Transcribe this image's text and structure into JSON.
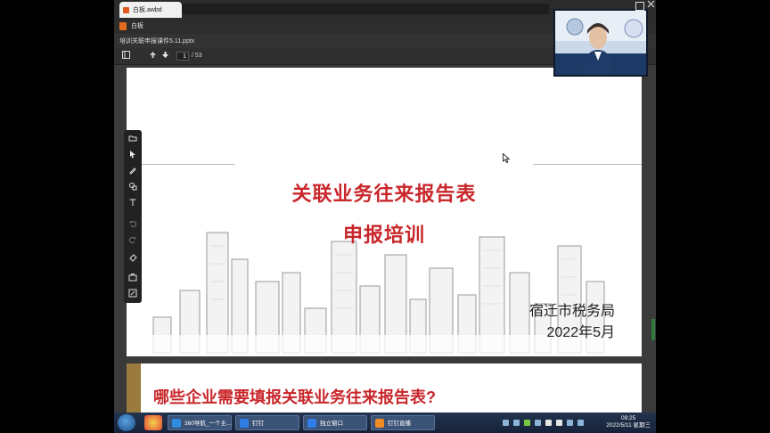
{
  "browser": {
    "tab_title": "白板.awbd"
  },
  "app": {
    "title": "白板"
  },
  "document": {
    "file_name": "培训关联申报课件5.11.pptx",
    "current_page": "1",
    "total_pages": "/ 53"
  },
  "slide1": {
    "title_line1": "关联业务往来报告表",
    "title_line2": "申报培训",
    "organization": "宿迁市税务局",
    "date": "2022年5月"
  },
  "slide2": {
    "heading": "哪些企业需要填报关联业务往来报告表?"
  },
  "annotation_tools": [
    "folder-add-icon",
    "select-arrow-icon",
    "pen-icon",
    "shapes-icon",
    "text-icon",
    "undo-icon",
    "redo-icon",
    "eraser-icon",
    "toolbox-icon",
    "edit-board-icon"
  ],
  "taskbar": {
    "tasks": [
      {
        "label": "360导航_一个主...",
        "icon": "ie-icon"
      },
      {
        "label": "钉钉",
        "icon": "dingtalk-icon"
      },
      {
        "label": "独立窗口",
        "icon": "dingtalk-icon"
      },
      {
        "label": "钉钉直播",
        "icon": "live-icon"
      }
    ],
    "time": "09:25",
    "date": "2022/5/11 星期三"
  },
  "colors": {
    "accent_red": "#c9272b",
    "slide_bar": "#9a7a3e",
    "taskbar": "#1b2a44"
  }
}
